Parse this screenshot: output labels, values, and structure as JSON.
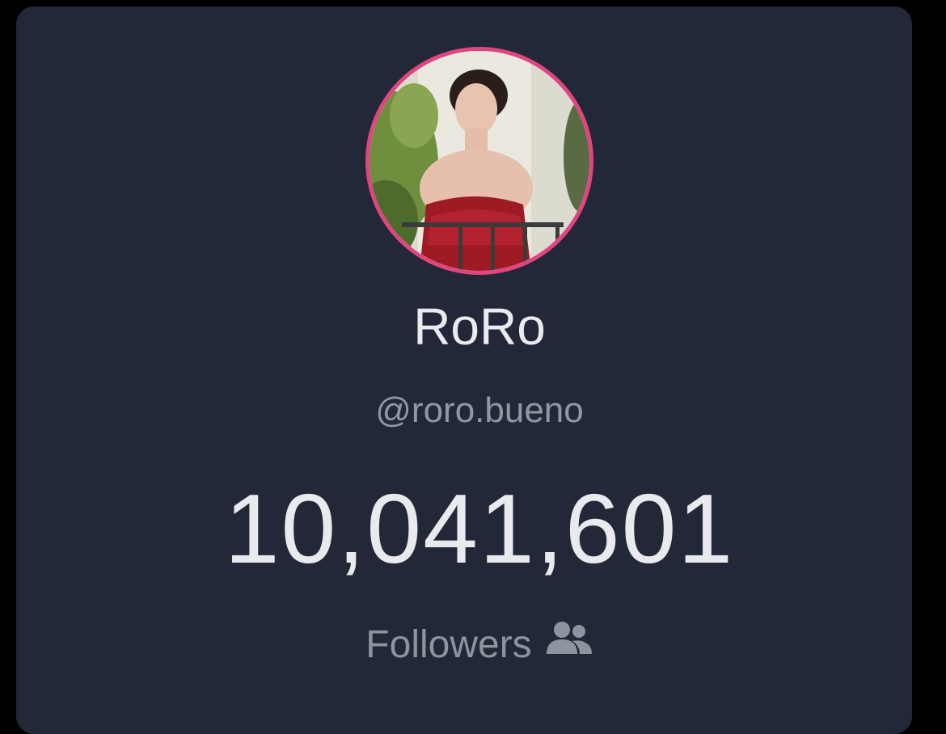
{
  "profile": {
    "display_name": "RoRo",
    "handle": "@roro.bueno",
    "follower_count": "10,041,601",
    "followers_label": "Followers",
    "followers_icon": "users-icon",
    "avatar_ring_color": "#e0457f"
  }
}
